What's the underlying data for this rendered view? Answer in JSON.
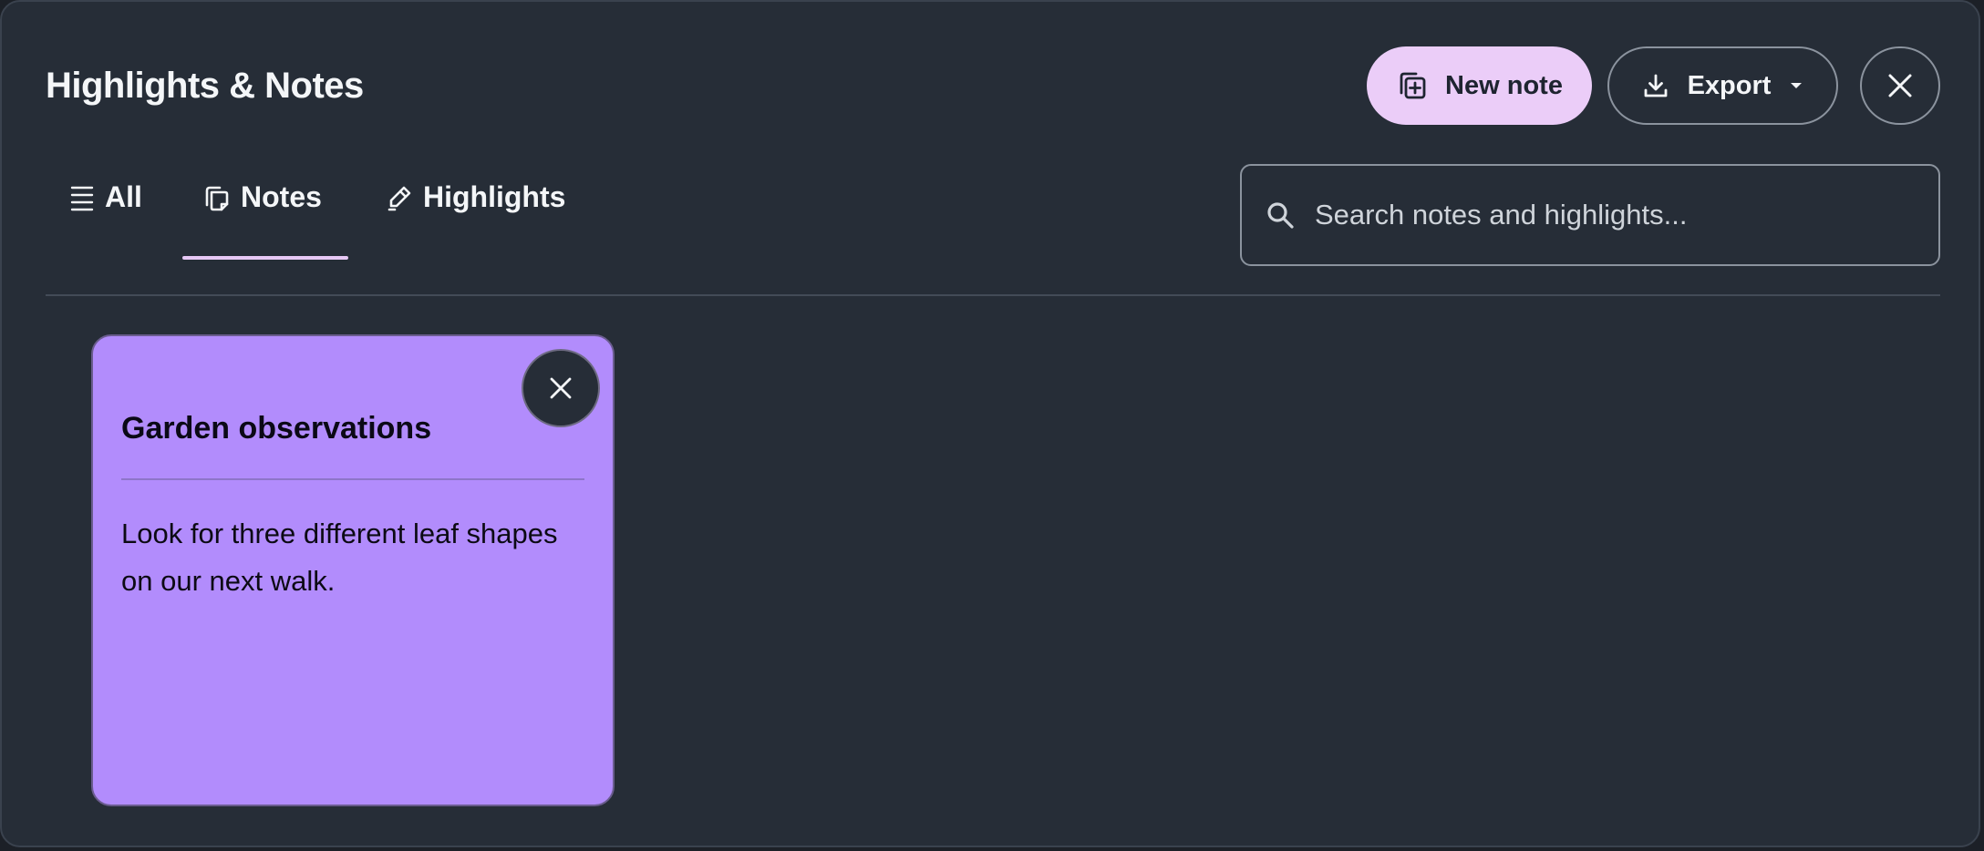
{
  "header": {
    "title": "Highlights & Notes",
    "new_note_label": "New note",
    "export_label": "Export"
  },
  "tabs": [
    {
      "label": "All",
      "icon": "list-icon",
      "active": false
    },
    {
      "label": "Notes",
      "icon": "notes-icon",
      "active": true
    },
    {
      "label": "Highlights",
      "icon": "pen-icon",
      "active": false
    }
  ],
  "search": {
    "placeholder": "Search notes and highlights...",
    "value": ""
  },
  "notes": [
    {
      "title": "Garden observations",
      "body": "Look for three different leaf shapes on our next walk.",
      "color": "#b28cfc"
    }
  ],
  "colors": {
    "background": "#262d37",
    "accent": "#ebcdf8",
    "note_purple": "#b28cfc"
  }
}
